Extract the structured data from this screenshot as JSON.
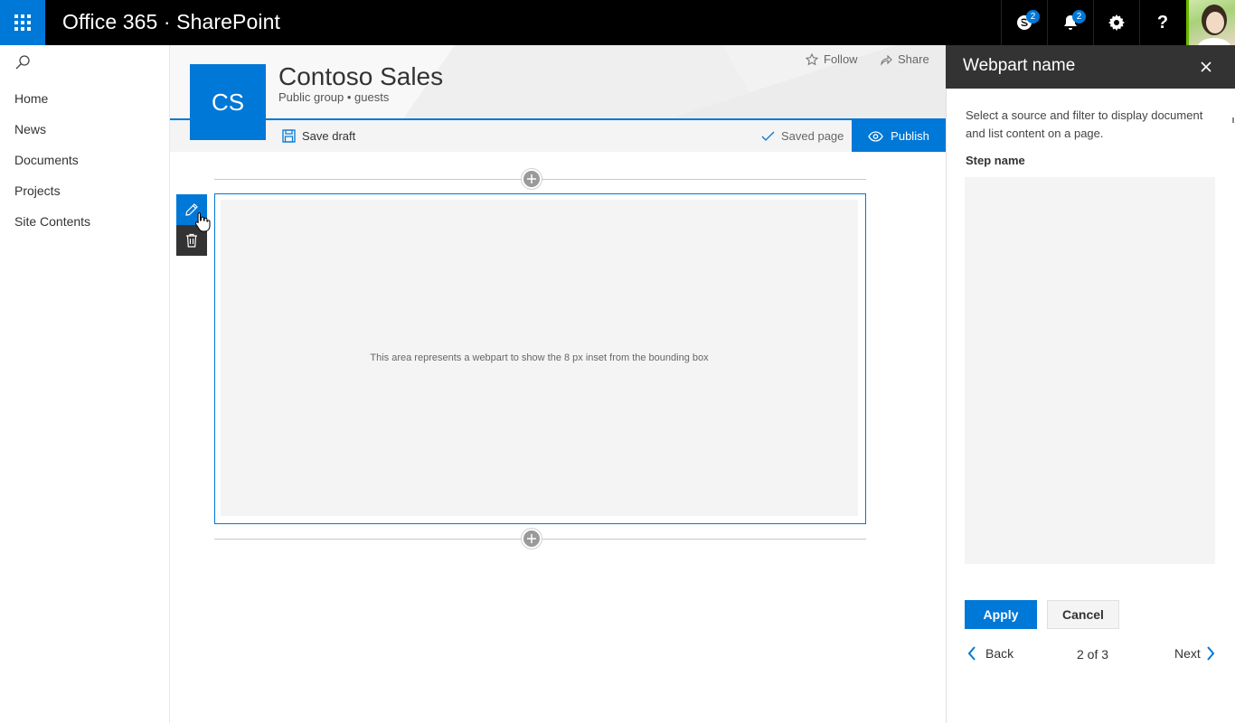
{
  "suite": {
    "title": "Office 365 · SharePoint",
    "skype_badge": "2",
    "notifications_badge": "2",
    "accent": "#0078d7"
  },
  "nav": {
    "items": [
      {
        "label": "Home"
      },
      {
        "label": "News"
      },
      {
        "label": "Documents"
      },
      {
        "label": "Projects"
      },
      {
        "label": "Site Contents"
      }
    ]
  },
  "site": {
    "logo_text": "CS",
    "title": "Contoso Sales",
    "subtitle": "Public group • guests",
    "follow_label": "Follow",
    "share_label": "Share"
  },
  "command": {
    "save_draft": "Save draft",
    "saved_page": "Saved page",
    "publish": "Publish"
  },
  "canvas": {
    "webpart_text": "This area represents a webpart to show the 8 px inset from the bounding box"
  },
  "panel": {
    "title": "Webpart name",
    "description": "Select a source and filter to display document and list content on a page.",
    "step_name": "Step name",
    "apply": "Apply",
    "cancel": "Cancel",
    "back": "Back",
    "page_count": "2 of 3",
    "next": "Next"
  }
}
